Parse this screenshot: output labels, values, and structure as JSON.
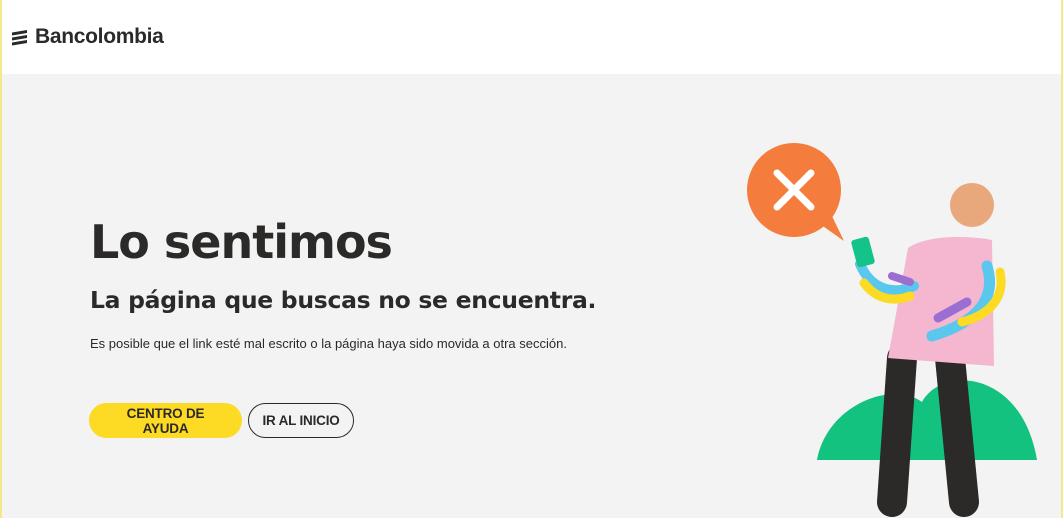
{
  "header": {
    "brand_name": "Bancolombia",
    "logo_icon": "bancolombia-stripes-icon"
  },
  "error": {
    "title": "Lo sentimos",
    "subtitle": "La página que buscas no se encuentra.",
    "description": "Es posible que el link esté mal escrito o la página haya sido movida a otra sección."
  },
  "actions": {
    "help_label": "CENTRO DE AYUDA",
    "home_label": "IR AL INICIO"
  },
  "illustration": {
    "icon": "error-x-icon",
    "colors": {
      "bubble": "#f47c3c",
      "shirt": "#f5b6cf",
      "head": "#e8a87c",
      "bush": "#12c27e",
      "pants": "#2c2a29",
      "phone": "#13c38a",
      "arm_blue": "#59c8ec",
      "arm_yellow": "#fdda24",
      "arm_purple": "#9b6fd1"
    }
  },
  "theme": {
    "primary_yellow": "#fdda24",
    "text_dark": "#2c2a29",
    "background": "#f3f3f3"
  }
}
